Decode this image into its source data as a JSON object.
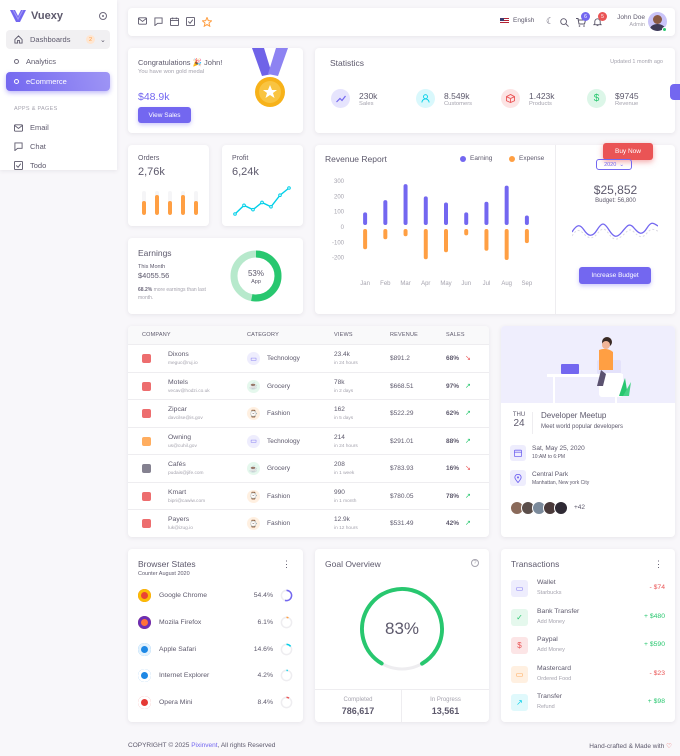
{
  "sidebar": {
    "brand": "Vuexy",
    "dashboards_label": "Dashboards",
    "dashboards_badge": "2",
    "items": [
      {
        "label": "Analytics"
      },
      {
        "label": "eCommerce"
      }
    ],
    "section_title": "APPS & PAGES",
    "apps": [
      {
        "label": "Email"
      },
      {
        "label": "Chat"
      },
      {
        "label": "Todo"
      }
    ]
  },
  "navbar": {
    "language": "English",
    "cart_count": "6",
    "notif_count": "5",
    "user_name": "John Doe",
    "user_role": "Admin"
  },
  "congrats": {
    "title": "Congratulations 🎉 John!",
    "subtitle": "You have won gold medal",
    "amount": "$48.9k",
    "button": "View Sales"
  },
  "statistics": {
    "title": "Statistics",
    "updated": "Updated 1 month ago",
    "items": [
      {
        "value": "230k",
        "label": "Sales"
      },
      {
        "value": "8.549k",
        "label": "Customers"
      },
      {
        "value": "1.423k",
        "label": "Products"
      },
      {
        "value": "$9745",
        "label": "Revenue"
      }
    ]
  },
  "orders": {
    "title": "Orders",
    "value": "2,76k",
    "bars": [
      0.6,
      0.85,
      0.6,
      0.85,
      0.6
    ]
  },
  "profit": {
    "title": "Profit",
    "value": "6,24k",
    "points": [
      2,
      8,
      5,
      10,
      7,
      15,
      20
    ]
  },
  "earnings": {
    "title": "Earnings",
    "period": "This Month",
    "amount": "$4055.56",
    "note_pct": "68.2%",
    "note_text": "more earnings than last month.",
    "percent": "53%",
    "percent_label": "App",
    "percent_value": 53
  },
  "revenue": {
    "title": "Revenue Report",
    "legend_earning": "Earning",
    "legend_expense": "Expense",
    "buy_now": "Buy Now",
    "year": "2020",
    "total": "$25,852",
    "budget": "Budget: 56,800",
    "budget_button": "Increase Budget"
  },
  "chart_data": {
    "type": "bar",
    "categories": [
      "Jan",
      "Feb",
      "Mar",
      "Apr",
      "May",
      "Jun",
      "Jul",
      "Aug",
      "Sep"
    ],
    "series": [
      {
        "name": "Earning",
        "values": [
          95,
          175,
          280,
          200,
          160,
          95,
          165,
          270,
          75
        ]
      },
      {
        "name": "Expense",
        "values": [
          -145,
          -80,
          -60,
          -210,
          -165,
          -55,
          -155,
          -215,
          -105
        ]
      }
    ],
    "yticks": [
      "300",
      "200",
      "100",
      "0",
      "-100",
      "-200"
    ],
    "ylim": [
      -300,
      300
    ]
  },
  "table": {
    "headers": [
      "COMPANY",
      "CATEGORY",
      "VIEWS",
      "REVENUE",
      "SALES"
    ],
    "rows": [
      {
        "name": "Dixons",
        "email": "meguc@ruj.io",
        "category": "Technology",
        "views": "23.4k",
        "period": "in 24 hours",
        "revenue": "$891.2",
        "sales": "68%",
        "trend": "down"
      },
      {
        "name": "Motels",
        "email": "vecav@hodzi.co.uk",
        "category": "Grocery",
        "views": "78k",
        "period": "in 2 days",
        "revenue": "$668.51",
        "sales": "97%",
        "trend": "up"
      },
      {
        "name": "Zipcar",
        "email": "davcilse@is.gov",
        "category": "Fashion",
        "views": "162",
        "period": "in 5 days",
        "revenue": "$522.29",
        "sales": "62%",
        "trend": "up"
      },
      {
        "name": "Owning",
        "email": "us@cuhil.gov",
        "category": "Technology",
        "views": "214",
        "period": "in 24 hours",
        "revenue": "$291.01",
        "sales": "88%",
        "trend": "up"
      },
      {
        "name": "Cafés",
        "email": "pudais@jife.com",
        "category": "Grocery",
        "views": "208",
        "period": "in 1 week",
        "revenue": "$783.93",
        "sales": "16%",
        "trend": "down"
      },
      {
        "name": "Kmart",
        "email": "bipri@cawiw.com",
        "category": "Fashion",
        "views": "990",
        "period": "in 1 month",
        "revenue": "$780.05",
        "sales": "78%",
        "trend": "up"
      },
      {
        "name": "Payers",
        "email": "luk@izug.io",
        "category": "Fashion",
        "views": "12.9k",
        "period": "in 12 hours",
        "revenue": "$531.49",
        "sales": "42%",
        "trend": "up"
      }
    ]
  },
  "meetup": {
    "day": "THU",
    "date": "24",
    "title": "Developer Meetup",
    "subtitle": "Meet world popular developers",
    "when": "Sat, May 25, 2020",
    "time": "10:AM to 6:PM",
    "place": "Central Park",
    "place_sub": "Manhattan, New york City",
    "more": "+42"
  },
  "browser": {
    "title": "Browser States",
    "subtitle": "Counter August 2020",
    "items": [
      {
        "name": "Google Chrome",
        "pct": "54.4%",
        "value": 54.4,
        "color": "#7367f0"
      },
      {
        "name": "Mozila Firefox",
        "pct": "6.1%",
        "value": 6.1,
        "color": "#ff9f43"
      },
      {
        "name": "Apple Safari",
        "pct": "14.6%",
        "value": 14.6,
        "color": "#00cfe8"
      },
      {
        "name": "Internet Explorer",
        "pct": "4.2%",
        "value": 4.2,
        "color": "#00cfe8"
      },
      {
        "name": "Opera Mini",
        "pct": "8.4%",
        "value": 8.4,
        "color": "#ea5455"
      }
    ]
  },
  "goal": {
    "title": "Goal Overview",
    "percent": "83%",
    "value": 83,
    "completed_label": "Completed",
    "completed": "786,617",
    "progress_label": "In Progress",
    "progress": "13,561"
  },
  "transactions": {
    "title": "Transactions",
    "items": [
      {
        "name": "Wallet",
        "sub": "Starbucks",
        "amount": "- $74",
        "color": "#ea5455",
        "bg": "#eeedfd",
        "fg": "#7367f0"
      },
      {
        "name": "Bank Transfer",
        "sub": "Add Money",
        "amount": "+ $480",
        "color": "#28c76f",
        "bg": "#e5f8ed",
        "fg": "#28c76f"
      },
      {
        "name": "Paypal",
        "sub": "Add Money",
        "amount": "+ $590",
        "color": "#28c76f",
        "bg": "#fce5e6",
        "fg": "#ea5455"
      },
      {
        "name": "Mastercard",
        "sub": "Ordered Food",
        "amount": "- $23",
        "color": "#ea5455",
        "bg": "#fff0e1",
        "fg": "#ff9f43"
      },
      {
        "name": "Transfer",
        "sub": "Refund",
        "amount": "+ $98",
        "color": "#28c76f",
        "bg": "#e0f9fc",
        "fg": "#00cfe8"
      }
    ]
  },
  "footer": {
    "copyright": "COPYRIGHT © 2025",
    "brand": "Pixinvent",
    "rights": ", All rights Reserved",
    "made": "Hand-crafted & Made with"
  }
}
